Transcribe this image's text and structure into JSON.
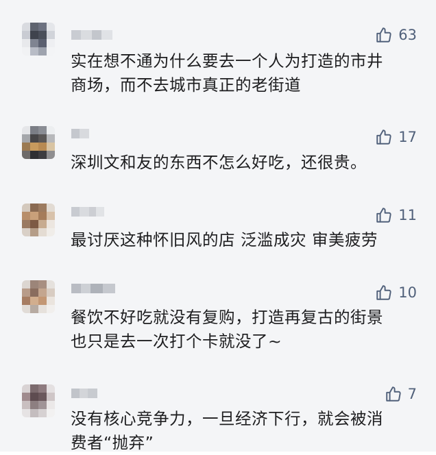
{
  "comments": [
    {
      "text": "实在想不通为什么要去一个人为打造的市井\n商场，而不去城市真正的老街道",
      "likes": "63",
      "thumb_icon": "thumbs-up-icon"
    },
    {
      "text": "深圳文和友的东西不怎么好吃，还很贵。",
      "likes": "17",
      "thumb_icon": "thumbs-up-icon"
    },
    {
      "text": "最讨厌这种怀旧风的店 泛滥成灾 审美疲劳",
      "likes": "11",
      "thumb_icon": "thumbs-up-icon"
    },
    {
      "text": "餐饮不好吃就没有复购，打造再复古的街景\n也只是去一次打个卡就没了~",
      "likes": "10",
      "thumb_icon": "thumbs-up-icon"
    },
    {
      "text": "没有核心竞争力，一旦经济下行，就会被消\n费者“抛弃”",
      "likes": "7",
      "thumb_icon": "thumbs-up-icon"
    }
  ],
  "colors": {
    "background": "#f4f5f7",
    "text": "#1d1d1f",
    "like": "#50607a"
  }
}
